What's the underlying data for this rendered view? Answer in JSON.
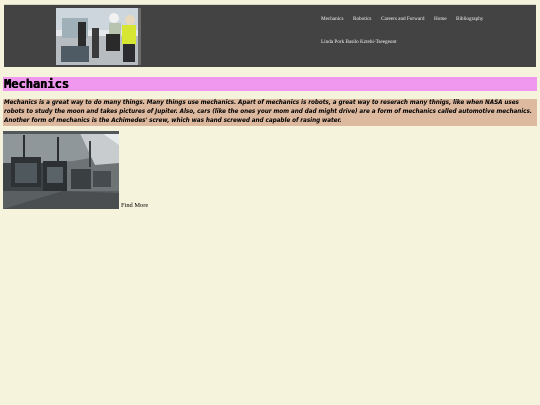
{
  "nav": {
    "links": [
      "Mechanics",
      "Robotics",
      "Careers and Forward",
      "Home",
      "Bibliography"
    ],
    "authors": "Linda Pork Basilo Kztehi-Tseegeont"
  },
  "main": {
    "heading": "Mechanics",
    "intro": "Mechanics is a great way to do many things. Many things use mechanics. Apart of mechanics is robots, a great way to reserach many thnigs, like when NASA uses robots to study the moon and takes pictures of Jupiter. Also, cars (like the ones your mom and dad might drive) are a form of mechanics called automotive mechanics. Another form of mechanics is the Achimedes' screw, which was hand screwed and capable of rasing water.",
    "find_more": "Find More"
  },
  "colors": {
    "header_bg": "#434343",
    "page_bg": "#f5f3dc",
    "heading_bg": "#f097ef",
    "intro_bg": "#ddb9a0"
  }
}
